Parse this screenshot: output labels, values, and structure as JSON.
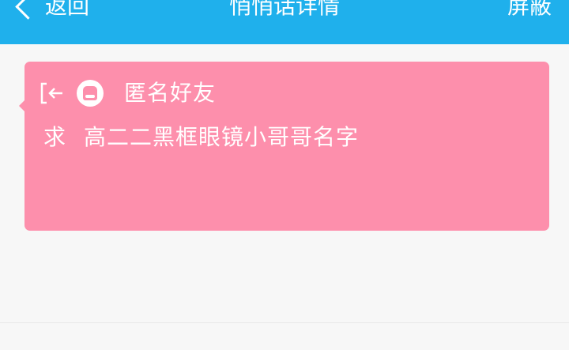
{
  "header": {
    "back_label": "返回",
    "title": "悄悄话详情",
    "block_label": "屏蔽"
  },
  "message": {
    "sender": "匿名好友",
    "prefix": "求",
    "text": "高二二黑框眼镜小哥哥名字"
  },
  "colors": {
    "header_bg": "#1fb0ec",
    "card_bg": "#fd8fac",
    "text_on_color": "#ffffff",
    "page_bg": "#f7f7f7"
  },
  "icons": {
    "back": "chevron-left-icon",
    "exit": "exit-icon",
    "avatar": "anonymous-avatar-icon"
  }
}
